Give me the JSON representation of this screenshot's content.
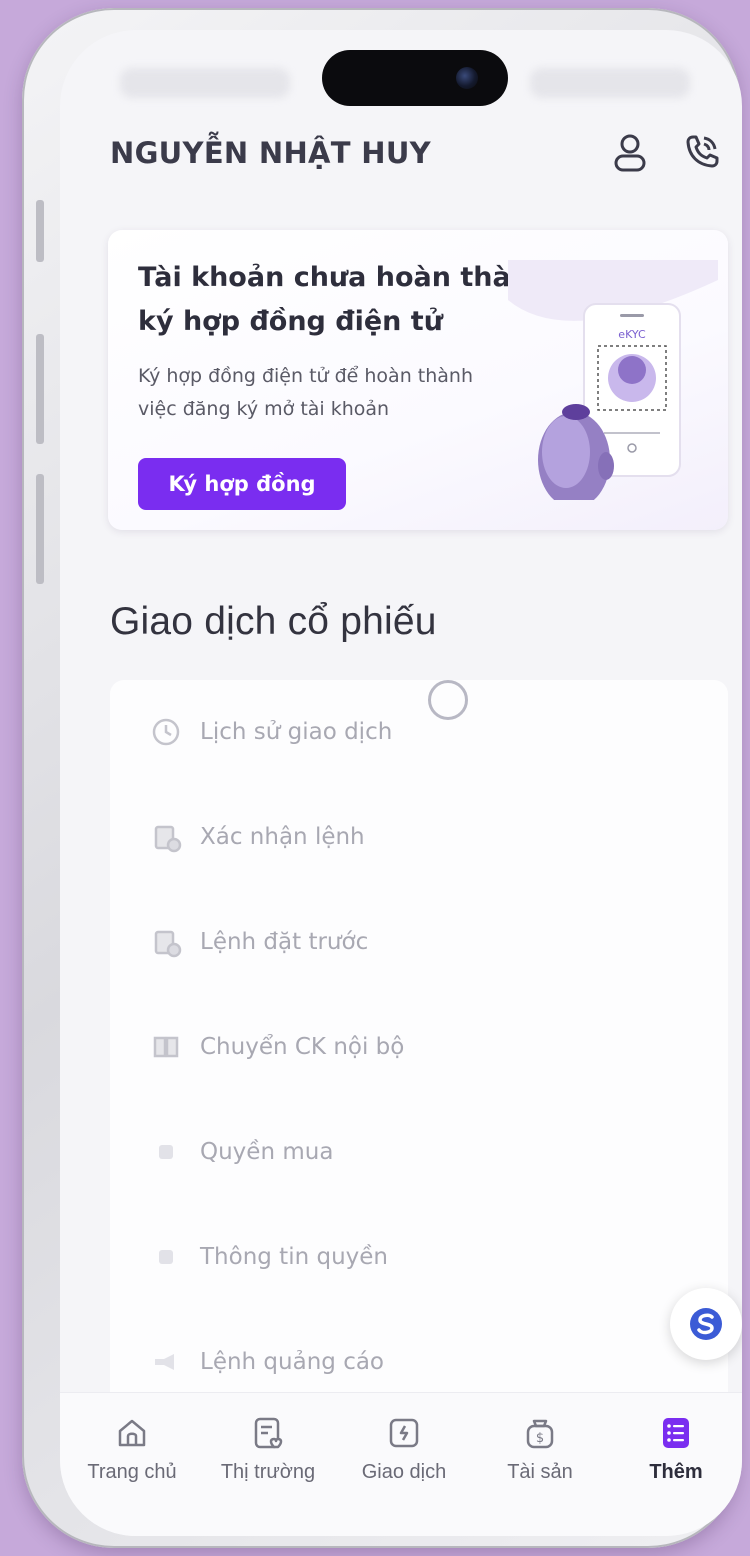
{
  "header": {
    "user_name": "NGUYỄN NHẬT HUY",
    "icons": [
      "user-icon",
      "phone-support-icon"
    ]
  },
  "banner": {
    "title_line1": "Tài khoản chưa hoàn thành",
    "title_line2": "ký hợp đồng điện tử",
    "desc_line1": "Ký hợp đồng điện tử để hoàn thành",
    "desc_line2": "việc đăng ký mở tài khoản",
    "button_label": "Ký hợp đồng",
    "illustration_label": "eKYC"
  },
  "section": {
    "title": "Giao dịch cổ phiếu",
    "items": [
      {
        "label": "Lịch sử giao dịch",
        "icon": "clock-icon"
      },
      {
        "label": "Xác nhận lệnh",
        "icon": "clipboard-check-icon"
      },
      {
        "label": "Lệnh đặt trước",
        "icon": "clipboard-clock-icon"
      },
      {
        "label": "Chuyển CK nội bộ",
        "icon": "transfer-icon"
      },
      {
        "label": "Quyền mua",
        "icon": "square-icon"
      },
      {
        "label": "Thông tin quyền",
        "icon": "square-icon"
      },
      {
        "label": "Lệnh quảng cáo",
        "icon": "megaphone-icon"
      }
    ]
  },
  "tabbar": {
    "tabs": [
      {
        "label": "Trang chủ",
        "icon": "home-icon"
      },
      {
        "label": "Thị trường",
        "icon": "market-icon"
      },
      {
        "label": "Giao dịch",
        "icon": "trade-icon"
      },
      {
        "label": "Tài sản",
        "icon": "wallet-icon"
      },
      {
        "label": "Thêm",
        "icon": "menu-icon"
      }
    ],
    "active_tab": "Thêm"
  },
  "colors": {
    "accent": "#7a2df0",
    "background": "#c6a9da",
    "fab_logo": "#3b5bd6"
  }
}
